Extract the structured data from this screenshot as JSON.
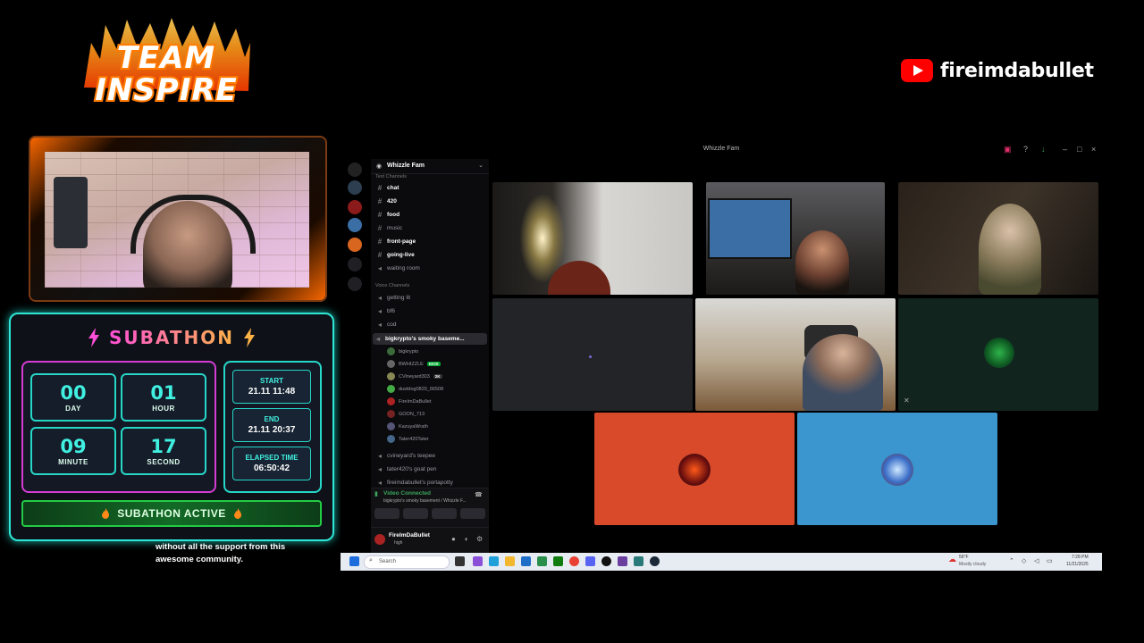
{
  "logo": {
    "line1": "TEAM",
    "line2": "INSPIRE"
  },
  "youtube": {
    "channel": "fireimdabullet",
    "icon": "youtube-icon"
  },
  "subathon": {
    "title": "SUBATHON",
    "days": "00",
    "days_label": "DAY",
    "hours": "01",
    "hours_label": "HOUR",
    "minutes": "09",
    "minutes_label": "MINUTE",
    "seconds": "17",
    "seconds_label": "SECOND",
    "start_label": "START",
    "start_value": "21.11 11:48",
    "end_label": "END",
    "end_value": "21.11 20:37",
    "elapsed_label": "ELAPSED TIME",
    "elapsed_value": "06:50:42",
    "status": "SUBATHON ACTIVE",
    "colors": {
      "accent": "#2ee6d6",
      "pink": "#ff55c8",
      "active": "#22cc44"
    }
  },
  "caption": {
    "line1": "without all the support from this",
    "line2": "awesome community."
  },
  "discord": {
    "window_title": "Whizzle Fam",
    "server_name": "Whizzle Fam",
    "text_category": "Text Channels",
    "text_channels": [
      {
        "name": "chat",
        "bold": true
      },
      {
        "name": "420",
        "bold": true
      },
      {
        "name": "food",
        "bold": true
      },
      {
        "name": "music",
        "bold": false
      },
      {
        "name": "front-page",
        "bold": true
      },
      {
        "name": "going-live",
        "bold": true
      }
    ],
    "waiting_room": "waiting room",
    "voice_category": "Voice Channels",
    "voice_channels_top": [
      "getting lit",
      "bf6",
      "cod"
    ],
    "active_voice": "bigkrypto's smoky baseme...",
    "voice_users": [
      {
        "name": "bigkrypto",
        "badge": ""
      },
      {
        "name": "BWHIZZLE",
        "badge": "KICK"
      },
      {
        "name": "CVineyard303",
        "badge": "2K"
      },
      {
        "name": "dustdog0820_66508",
        "badge": ""
      },
      {
        "name": "FireImDaBullet",
        "badge": ""
      },
      {
        "name": "GOON_713",
        "badge": ""
      },
      {
        "name": "KazuyaWrath",
        "badge": ""
      },
      {
        "name": "Tater420Tater",
        "badge": ""
      }
    ],
    "voice_channels_bottom": [
      "cvineyard's teepee",
      "tater420's goat pen",
      "fireimdabullet's portapotty"
    ],
    "connection_status": "Video Connected",
    "connection_detail": "bigkrypto's smoky basement / Whizzle F...",
    "user_name": "FireImDaBullet",
    "user_status": "high"
  },
  "taskbar": {
    "search_placeholder": "Search",
    "weather": "Mostly cloudy",
    "temp": "56°F",
    "time": "7:28 PM",
    "date": "11/21/2025"
  }
}
